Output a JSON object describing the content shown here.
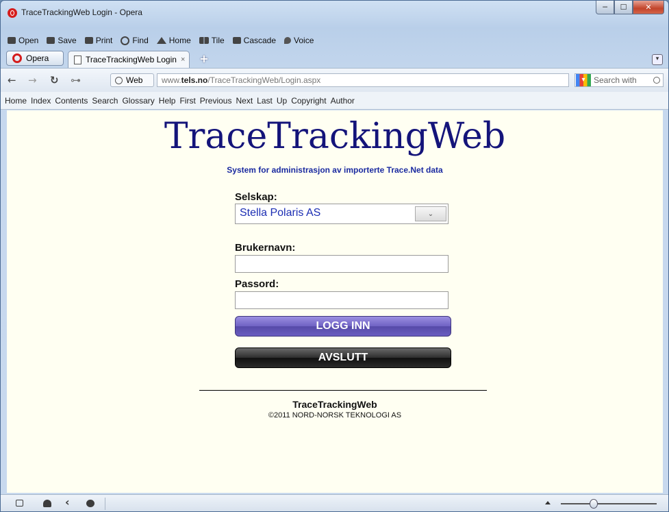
{
  "window": {
    "title": "TraceTrackingWeb Login - Opera",
    "controls": {
      "minimize": "─",
      "maximize": "☐",
      "close": "✕"
    }
  },
  "menubar": {
    "items": [
      {
        "label": "Open",
        "icon": "folder-icon"
      },
      {
        "label": "Save",
        "icon": "save-icon"
      },
      {
        "label": "Print",
        "icon": "print-icon"
      },
      {
        "label": "Find",
        "icon": "find-icon"
      },
      {
        "label": "Home",
        "icon": "home-icon"
      },
      {
        "label": "Tile",
        "icon": "tile-icon"
      },
      {
        "label": "Cascade",
        "icon": "cascade-icon"
      },
      {
        "label": "Voice",
        "icon": "voice-icon"
      }
    ]
  },
  "tabs": {
    "opera_menu": "Opera",
    "active_tab": "TraceTrackingWeb Login",
    "tab_close": "×",
    "new_tab": "+",
    "tab_menu": "▾"
  },
  "navbar": {
    "site_badge": "Web",
    "url_prefix": "www.",
    "url_domain": "tels.no",
    "url_path": "/TraceTrackingWeb/Login.aspx",
    "search_placeholder": "Search with",
    "buttons": {
      "back": "←",
      "forward": "→",
      "reload": "↻",
      "key": "⊶"
    }
  },
  "linkbar": {
    "items": [
      "Home",
      "Index",
      "Contents",
      "Search",
      "Glossary",
      "Help",
      "First",
      "Previous",
      "Next",
      "Last",
      "Up",
      "Copyright",
      "Author"
    ]
  },
  "page": {
    "brand": "TraceTrackingWeb",
    "tagline": "System for administrasjon av importerte Trace.Net data",
    "company_label": "Selskap:",
    "company_value": "Stella Polaris AS",
    "dropdown_arrow": "⌄",
    "username_label": "Brukernavn:",
    "username_value": "",
    "password_label": "Passord:",
    "password_value": "",
    "login_button": "LOGG INN",
    "exit_button": "AVSLUTT",
    "footer_title": "TraceTrackingWeb",
    "footer_copyright": "©2011 NORD-NORSK TEKNOLOGI AS"
  },
  "colors": {
    "brand": "#14147a",
    "tagline": "#1a2aa0",
    "login_button": "#6f62c4",
    "exit_button": "#2e2e2e",
    "page_background": "#fffff2"
  }
}
